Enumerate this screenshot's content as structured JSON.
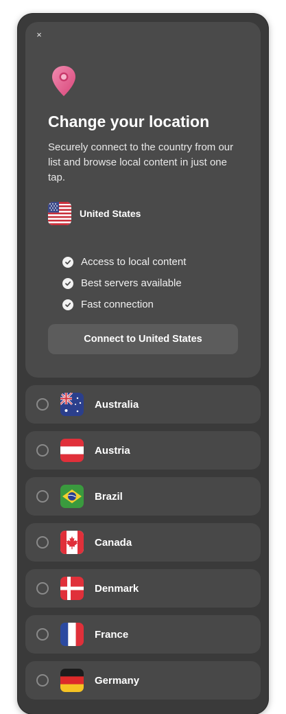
{
  "hero": {
    "close_glyph": "×",
    "title": "Change your location",
    "subtitle": "Securely connect to the country from our list and browse local content in just one tap.",
    "current_country": "United States",
    "features": [
      "Access to local content",
      "Best servers available",
      "Fast connection"
    ],
    "connect_label": "Connect to United States",
    "accent_color": "#e35c8c"
  },
  "countries": [
    {
      "name": "Australia",
      "flag_icon": "flag-australia-icon",
      "selected": false
    },
    {
      "name": "Austria",
      "flag_icon": "flag-austria-icon",
      "selected": false
    },
    {
      "name": "Brazil",
      "flag_icon": "flag-brazil-icon",
      "selected": false
    },
    {
      "name": "Canada",
      "flag_icon": "flag-canada-icon",
      "selected": false
    },
    {
      "name": "Denmark",
      "flag_icon": "flag-denmark-icon",
      "selected": false
    },
    {
      "name": "France",
      "flag_icon": "flag-france-icon",
      "selected": false
    },
    {
      "name": "Germany",
      "flag_icon": "flag-germany-icon",
      "selected": false
    }
  ]
}
